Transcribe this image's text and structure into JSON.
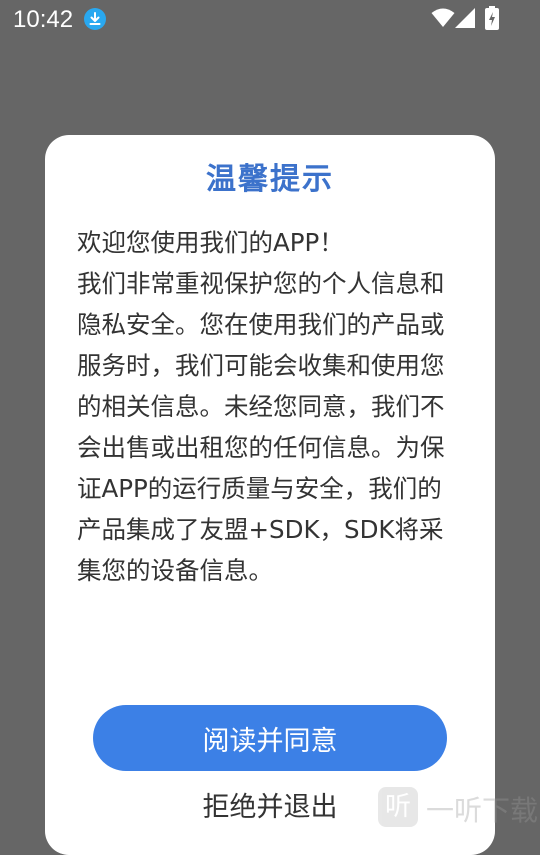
{
  "status_bar": {
    "time": "10:42",
    "icons": [
      "download-icon",
      "wifi-icon",
      "signal-icon",
      "battery-icon"
    ]
  },
  "dialog": {
    "title": "温馨提示",
    "body": "欢迎您使用我们的APP！\n我们非常重视保护您的个人信息和隐私安全。您在使用我们的产品或服务时，我们可能会收集和使用您的相关信息。未经您同意，我们不会出售或出租您的任何信息。为保证APP的运行质量与安全，我们的产品集成了友盟+SDK，SDK将采集您的设备信息。",
    "agree_label": "阅读并同意",
    "reject_label": "拒绝并退出"
  },
  "watermark": {
    "logo_glyph": "听",
    "text": "一听下载"
  },
  "colors": {
    "overlay": "#666666",
    "title": "#3C72CB",
    "primary_button": "#3C80E6",
    "body_text": "#333333"
  }
}
